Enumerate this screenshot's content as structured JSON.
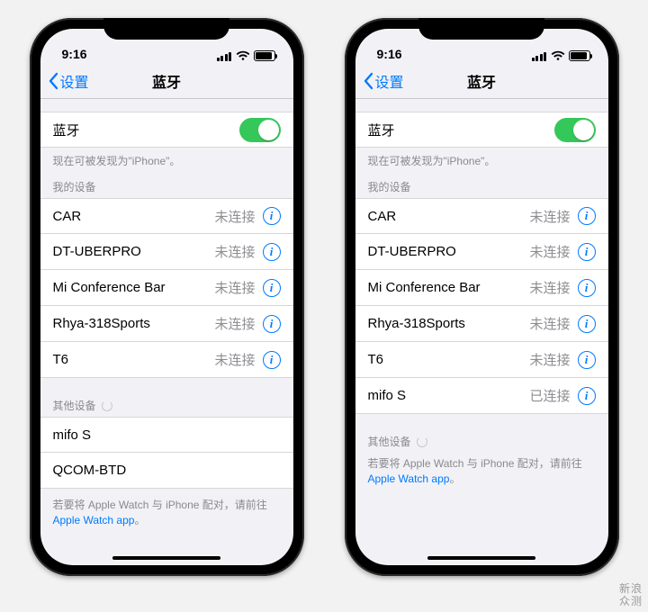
{
  "watermark": {
    "top": "新浪",
    "bottom": "众测"
  },
  "phones": [
    {
      "statusbar": {
        "time": "9:16"
      },
      "nav": {
        "back": "设置",
        "title": "蓝牙"
      },
      "bluetooth": {
        "label": "蓝牙",
        "on": true
      },
      "discover": "现在可被发现为\"iPhone\"。",
      "myDevicesHeader": "我的设备",
      "myDevices": [
        {
          "name": "CAR",
          "status": "未连接"
        },
        {
          "name": "DT-UBERPRO",
          "status": "未连接"
        },
        {
          "name": "Mi Conference Bar",
          "status": "未连接"
        },
        {
          "name": "Rhya-318Sports",
          "status": "未连接"
        },
        {
          "name": "T6",
          "status": "未连接"
        }
      ],
      "otherHeader": "其他设备",
      "otherDevices": [
        {
          "name": "mifo S"
        },
        {
          "name": "QCOM-BTD"
        }
      ],
      "note": {
        "pre": "若要将 Apple Watch 与 iPhone 配对，请前往 ",
        "link": "Apple Watch app",
        "post": "。"
      }
    },
    {
      "statusbar": {
        "time": "9:16"
      },
      "nav": {
        "back": "设置",
        "title": "蓝牙"
      },
      "bluetooth": {
        "label": "蓝牙",
        "on": true
      },
      "discover": "现在可被发现为\"iPhone\"。",
      "myDevicesHeader": "我的设备",
      "myDevices": [
        {
          "name": "CAR",
          "status": "未连接"
        },
        {
          "name": "DT-UBERPRO",
          "status": "未连接"
        },
        {
          "name": "Mi Conference Bar",
          "status": "未连接"
        },
        {
          "name": "Rhya-318Sports",
          "status": "未连接"
        },
        {
          "name": "T6",
          "status": "未连接"
        },
        {
          "name": "mifo S",
          "status": "已连接"
        }
      ],
      "otherHeader": "其他设备",
      "otherDevices": [],
      "note": {
        "pre": "若要将 Apple Watch 与 iPhone 配对，请前往 ",
        "link": "Apple Watch app",
        "post": "。"
      }
    }
  ]
}
